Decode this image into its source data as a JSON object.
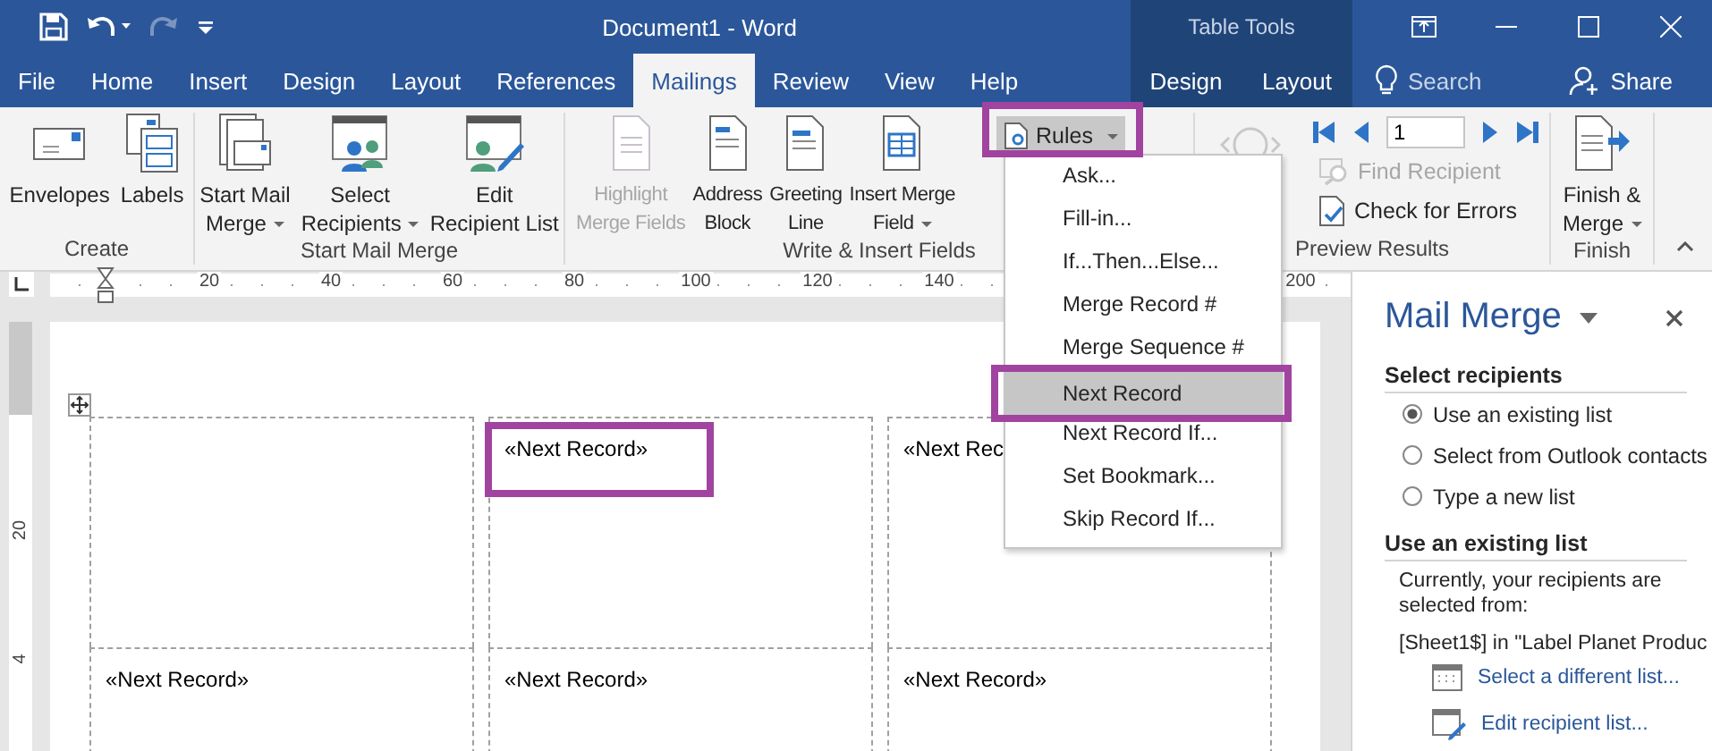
{
  "window": {
    "title": "Document1 - Word",
    "context_label": "Table Tools"
  },
  "tabs": [
    {
      "label": "File",
      "selected": false,
      "contextual": false
    },
    {
      "label": "Home",
      "selected": false,
      "contextual": false
    },
    {
      "label": "Insert",
      "selected": false,
      "contextual": false
    },
    {
      "label": "Design",
      "selected": false,
      "contextual": false
    },
    {
      "label": "Layout",
      "selected": false,
      "contextual": false
    },
    {
      "label": "References",
      "selected": false,
      "contextual": false
    },
    {
      "label": "Mailings",
      "selected": true,
      "contextual": false
    },
    {
      "label": "Review",
      "selected": false,
      "contextual": false
    },
    {
      "label": "View",
      "selected": false,
      "contextual": false
    },
    {
      "label": "Help",
      "selected": false,
      "contextual": false
    },
    {
      "label": "Design",
      "selected": false,
      "contextual": true
    },
    {
      "label": "Layout",
      "selected": false,
      "contextual": true
    }
  ],
  "tell_me": {
    "placeholder": "Search"
  },
  "share": "Share",
  "ribbon_groups": [
    {
      "kind": "large",
      "label": "Create",
      "buttons": [
        {
          "kind": "envelope",
          "lines": [
            "Envelopes"
          ],
          "dropdown": false,
          "disabled": false
        },
        {
          "kind": "labels",
          "lines": [
            "Labels"
          ],
          "dropdown": false,
          "disabled": false
        }
      ]
    },
    {
      "kind": "large",
      "label": "Start Mail Merge",
      "buttons": [
        {
          "kind": "start-merge",
          "lines": [
            "Start Mail",
            "Merge"
          ],
          "dropdown": true,
          "disabled": false
        },
        {
          "kind": "select-recipients",
          "lines": [
            "Select",
            "Recipients"
          ],
          "dropdown": true,
          "disabled": false
        },
        {
          "kind": "edit-list",
          "lines": [
            "Edit",
            "Recipient List"
          ],
          "dropdown": false,
          "disabled": false
        }
      ]
    },
    {
      "kind": "large",
      "label": "Write & Insert Fields",
      "buttons": [
        {
          "kind": "highlight",
          "lines": [
            "Highlight",
            "Merge Fields"
          ],
          "dropdown": false,
          "disabled": true
        },
        {
          "kind": "address",
          "lines": [
            "Address",
            "Block"
          ],
          "dropdown": false,
          "disabled": false
        },
        {
          "kind": "greeting",
          "lines": [
            "Greeting",
            "Line"
          ],
          "dropdown": false,
          "disabled": false
        },
        {
          "kind": "insert-field",
          "lines": [
            "Insert Merge",
            "Field"
          ],
          "dropdown": true,
          "disabled": false
        }
      ],
      "small_buttons": [
        {
          "kind": "rules",
          "label": "Rules",
          "dropdown": true,
          "pressed": true
        }
      ]
    },
    {
      "kind": "preview",
      "label": "Preview Results",
      "preview_disabled": true,
      "record": "1",
      "find": {
        "label": "Find Recipient",
        "disabled": true
      },
      "check": {
        "label": "Check for Errors",
        "disabled": false
      }
    },
    {
      "kind": "large",
      "label": "Finish",
      "buttons": [
        {
          "kind": "finish",
          "lines": [
            "Finish &",
            "Merge"
          ],
          "dropdown": true,
          "disabled": false
        }
      ]
    }
  ],
  "rules_menu": {
    "items": [
      {
        "label": "Ask...",
        "selected": false
      },
      {
        "label": "Fill-in...",
        "selected": false
      },
      {
        "label": "If...Then...Else...",
        "selected": false
      },
      {
        "label": "Merge Record #",
        "selected": false
      },
      {
        "label": "Merge Sequence #",
        "selected": false
      },
      {
        "label": "Next Record",
        "selected": true
      },
      {
        "label": "Next Record If...",
        "selected": false
      },
      {
        "label": "Set Bookmark...",
        "selected": false
      },
      {
        "label": "Skip Record If...",
        "selected": false
      }
    ]
  },
  "ruler": {
    "h_labels": [
      "20",
      "40",
      "60",
      "80",
      "100",
      "120",
      "140",
      "200"
    ],
    "v_labels": [
      "20",
      "4"
    ]
  },
  "table": {
    "rows": [
      {
        "cells": [
          {},
          {
            "text": "«Next Record»"
          },
          {
            "text": "«Next Rec"
          }
        ]
      },
      {
        "cells": [
          {
            "text": "«Next Record»"
          },
          {
            "text": "«Next Record»"
          },
          {
            "text": "«Next Record»"
          }
        ]
      }
    ]
  },
  "task_pane": {
    "title": "Mail Merge",
    "select_heading": "Select recipients",
    "options": [
      {
        "label": "Use an existing list",
        "selected": true
      },
      {
        "label": "Select from Outlook contacts",
        "selected": false
      },
      {
        "label": "Type a new list",
        "selected": false
      }
    ],
    "list_heading": "Use an existing list",
    "description": "Currently, your recipients are selected from:",
    "source": "[Sheet1$] in \"Label Planet Produc",
    "links": [
      {
        "kind": "select-list",
        "label": "Select a different list..."
      },
      {
        "kind": "edit-list",
        "label": "Edit recipient list..."
      }
    ]
  }
}
